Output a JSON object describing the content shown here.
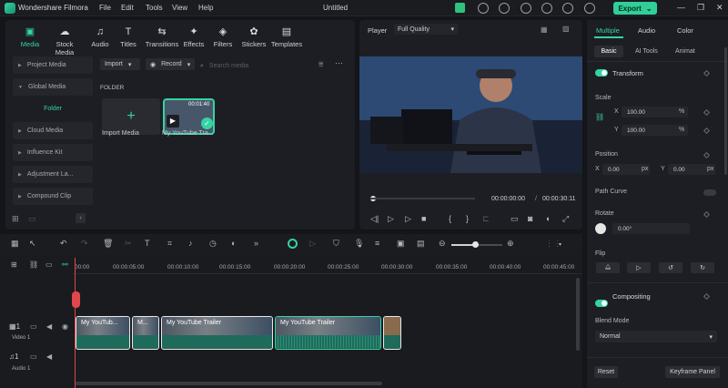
{
  "app": {
    "name": "Wondershare Filmora",
    "title": "Untitled",
    "export_label": "Export"
  },
  "menu": [
    "File",
    "Edit",
    "Tools",
    "View",
    "Help"
  ],
  "media_tabs": [
    {
      "label": "Media",
      "icon": "folder-icon"
    },
    {
      "label": "Stock Media",
      "icon": "cloud-icon"
    },
    {
      "label": "Audio",
      "icon": "music-icon"
    },
    {
      "label": "Titles",
      "icon": "text-icon"
    },
    {
      "label": "Transitions",
      "icon": "transition-icon"
    },
    {
      "label": "Effects",
      "icon": "sparkle-icon"
    },
    {
      "label": "Filters",
      "icon": "filter-icon"
    },
    {
      "label": "Stickers",
      "icon": "sticker-icon"
    },
    {
      "label": "Templates",
      "icon": "templates-icon"
    }
  ],
  "sidebar": [
    {
      "label": "Project Media"
    },
    {
      "label": "Global Media"
    },
    {
      "label": "Folder"
    },
    {
      "label": "Cloud Media"
    },
    {
      "label": "Influence Kit"
    },
    {
      "label": "Adjustment La..."
    },
    {
      "label": "Compound Clip"
    }
  ],
  "media": {
    "import_label": "Import",
    "record_label": "Record",
    "search_placeholder": "Search media",
    "folder_label": "FOLDER",
    "import_card_label": "Import Media",
    "clip_name": "My YouTube Tra...",
    "clip_duration": "00:01:40"
  },
  "player": {
    "label": "Player",
    "quality": "Full Quality",
    "current_time": "00:00:00:00",
    "separator": "/",
    "total_time": "00:00:30:11"
  },
  "properties": {
    "tabs": [
      "Multiple",
      "Audio",
      "Color"
    ],
    "subtabs": [
      "Basic",
      "AI Tools",
      "Animat"
    ],
    "transform": "Transform",
    "scale": "Scale",
    "scale_x_label": "X",
    "scale_x": "100.00",
    "scale_y_label": "Y",
    "scale_y": "100.00",
    "unit_percent": "%",
    "position": "Position",
    "pos_x_label": "X",
    "pos_x": "0.00",
    "pos_y_label": "Y",
    "pos_y": "0.00",
    "unit_px": "px",
    "path_curve": "Path Curve",
    "rotate": "Rotate",
    "rotate_value": "0.00°",
    "flip": "Flip",
    "compositing": "Compositing",
    "blend_mode": "Blend Mode",
    "blend_value": "Normal",
    "reset": "Reset",
    "keyframe_panel": "Keyframe Panel"
  },
  "timeline": {
    "ticks": [
      "00:00",
      "00:00:05:00",
      "00:00:10:00",
      "00:00:15:00",
      "00:00:20:00",
      "00:00:25:00",
      "00:00:30:00",
      "00:00:35:00",
      "00:00:40:00",
      "00:00:45:00"
    ],
    "video_track": "Video 1",
    "audio_track": "Audio 1",
    "video_track_num": "1",
    "audio_track_num": "1",
    "clips": [
      "My YouTub...",
      "M...",
      "My YouTube Trailer",
      "My YouTube Trailer",
      ""
    ]
  },
  "colors": {
    "accent": "#35d3a3",
    "playhead": "#e0474c",
    "bg": "#141518"
  }
}
